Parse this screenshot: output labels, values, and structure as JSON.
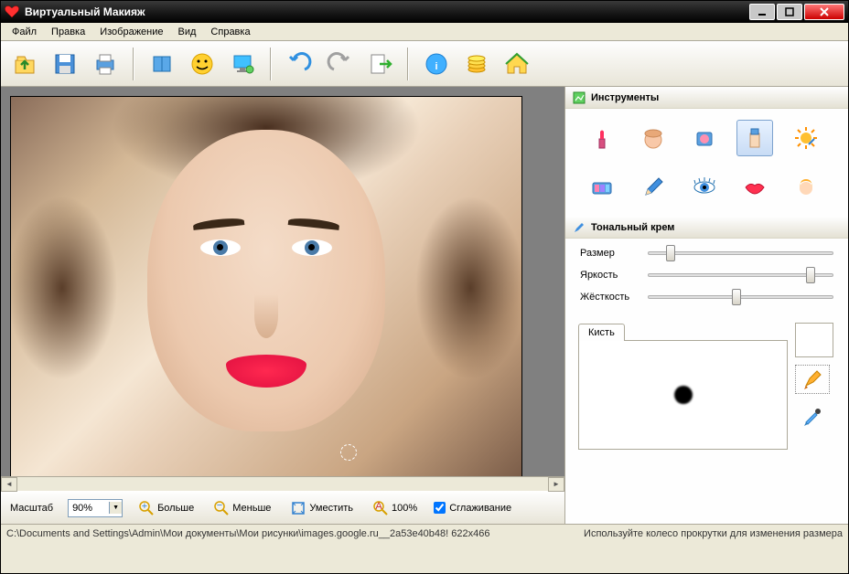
{
  "window": {
    "title": "Виртуальный Макияж"
  },
  "menu": {
    "file": "Файл",
    "edit": "Правка",
    "image": "Изображение",
    "view": "Вид",
    "help": "Справка"
  },
  "toolbar": {
    "open": "open-icon",
    "save": "save-icon",
    "print": "print-icon",
    "album": "album-icon",
    "smile": "smile-icon",
    "screen": "screen-icon",
    "undo": "undo-icon",
    "redo": "redo-icon",
    "export": "export-icon",
    "info": "info-icon",
    "coins": "coins-icon",
    "home": "home-icon"
  },
  "zoom": {
    "label": "Масштаб",
    "value": "90%",
    "more": "Больше",
    "less": "Меньше",
    "fit": "Уместить",
    "hundred": "100%",
    "smooth": "Сглаживание",
    "smooth_checked": true
  },
  "panels": {
    "tools_title": "Инструменты",
    "current_tool_title": "Тональный крем",
    "tools": [
      {
        "name": "lipstick-icon",
        "selected": false
      },
      {
        "name": "powder-icon",
        "selected": false
      },
      {
        "name": "blush-icon",
        "selected": false
      },
      {
        "name": "foundation-icon",
        "selected": true
      },
      {
        "name": "sun-icon",
        "selected": false
      },
      {
        "name": "eyeshadow-icon",
        "selected": false
      },
      {
        "name": "pencil-icon",
        "selected": false
      },
      {
        "name": "eye-icon",
        "selected": false
      },
      {
        "name": "lips-icon",
        "selected": false
      },
      {
        "name": "hair-icon",
        "selected": false
      }
    ],
    "sliders": {
      "size": {
        "label": "Размер",
        "value": 12
      },
      "brightness": {
        "label": "Яркость",
        "value": 88
      },
      "hardness": {
        "label": "Жёсткость",
        "value": 48
      }
    },
    "brush_tab": "Кисть"
  },
  "status": {
    "left": "C:\\Documents and Settings\\Admin\\Мои документы\\Мои рисунки\\images.google.ru__2a53e40b48! 622x466",
    "right": "Используйте колесо прокрутки для изменения размера"
  }
}
